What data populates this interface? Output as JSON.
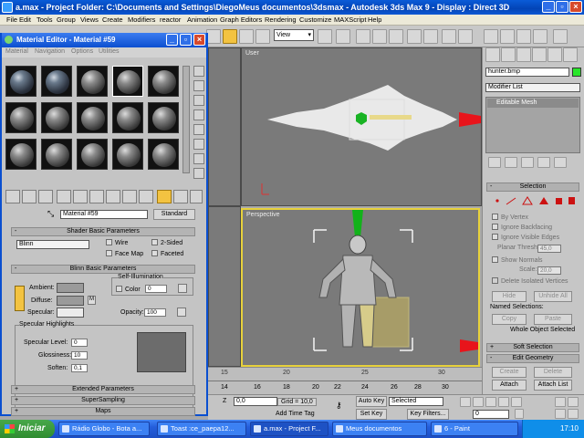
{
  "window": {
    "title": "a.max    - Project Folder: C:\\Documents and Settings\\DiegoMeus documentos\\3dsmax    - Autodesk 3ds Max 9    - Display : Direct 3D"
  },
  "menu": [
    "File",
    "Edit",
    "Tools",
    "Group",
    "Views",
    "Create",
    "Modifiers",
    "reactor",
    "Animation",
    "Graph Editors",
    "Rendering",
    "Customize",
    "MAXScript",
    "Help"
  ],
  "toolbar": {
    "viewcoord": "View"
  },
  "viewports": {
    "top_label": "User",
    "persp_label": "Perspective"
  },
  "material_editor": {
    "title": "Material Editor - Material #59",
    "menu": [
      "Material",
      "Navigation",
      "Options",
      "Utilities"
    ],
    "material_name": "Material #59",
    "type_button": "Standard",
    "shader_rollout": "Shader Basic Parameters",
    "shader": "Blinn",
    "shader_options": [
      "Wire",
      "2-Sided",
      "Face Map",
      "Faceted"
    ],
    "blinn_rollout": "Blinn Basic Parameters",
    "self_illum_label": "Self-Illumination",
    "color_label": "Color",
    "color_value": "0",
    "ambient": "Ambient:",
    "diffuse": "Diffuse:",
    "specular": "Specular:",
    "opacity_label": "Opacity:",
    "opacity_value": "100",
    "highlights_label": "Specular Highlights",
    "spec_level_label": "Specular Level:",
    "spec_level": "0",
    "glossiness_label": "Glossiness:",
    "glossiness": "10",
    "soften_label": "Soften:",
    "soften": "0,1",
    "rollouts": [
      "Extended Parameters",
      "SuperSampling",
      "Maps"
    ],
    "colors": {
      "ambient": "#9a9a9a",
      "diffuse": "#9a9a9a",
      "specular": "#ececec"
    }
  },
  "command_panel": {
    "object_name": "hunter.bmp",
    "modifier_list": "Modifier List",
    "stack_item": "Editable Mesh",
    "selection_rollout": "Selection",
    "by_vertex": "By Vertex",
    "ignore_backfacing": "Ignore Backfacing",
    "ignore_visible_edges": "Ignore Visible Edges",
    "planar_thresh_label": "Planar Thresh:",
    "planar_thresh": "45,0",
    "show_normals": "Show Normals",
    "scale_label": "Scale:",
    "scale": "20,0",
    "delete_isolated": "Delete Isolated Vertices",
    "hide": "Hide",
    "unhide_all": "Unhide All",
    "named_selections": "Named Selections:",
    "copy": "Copy",
    "paste": "Paste",
    "whole_object": "Whole Object Selected",
    "soft_selection": "Soft Selection",
    "edit_geometry": "Edit Geometry",
    "create": "Create",
    "delete": "Delete",
    "attach": "Attach",
    "attach_list": "Attach List"
  },
  "timeline": {
    "ticks": [
      "15",
      "20",
      "25",
      "30"
    ],
    "frames": [
      "14",
      "16",
      "18",
      "20",
      "22",
      "24",
      "26",
      "28",
      "30"
    ]
  },
  "status": {
    "z_label": "Z",
    "z_value": "0,0",
    "grid": "Grid = 10,0",
    "auto_key": "Auto Key",
    "selected": "Selected",
    "set_key": "Set Key",
    "key_filters": "Key Filters...",
    "add_time_tag": "Add Time Tag",
    "frame": "0"
  },
  "taskbar": {
    "start": "Iniciar",
    "tasks": [
      "Rádio Globo - Bota a...",
      "Toast :ce_paepa12...",
      "a.max - Project F...",
      "Meus documentos",
      "6 - Paint"
    ],
    "clock": "17:10"
  }
}
